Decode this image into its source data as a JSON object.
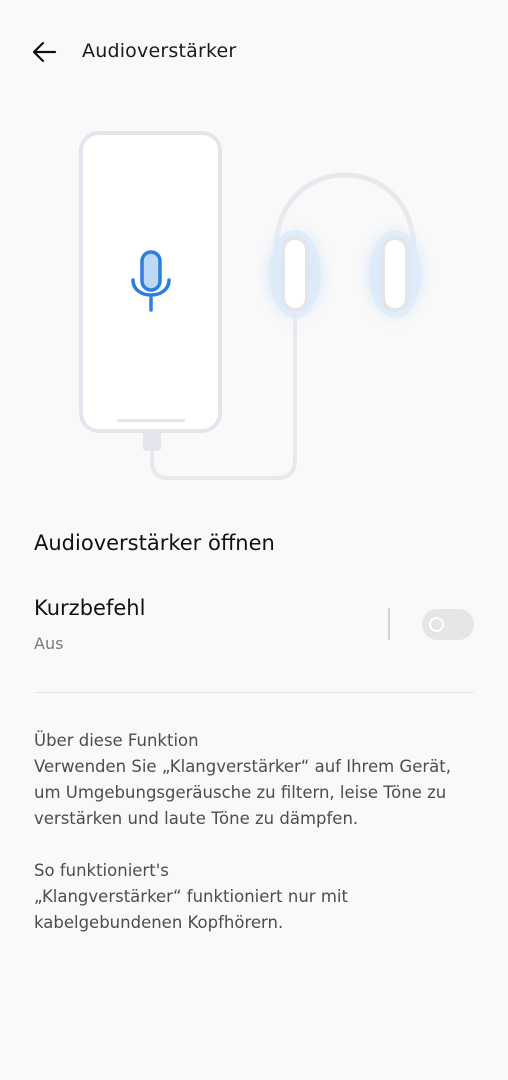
{
  "header": {
    "title": "Audioverstärker"
  },
  "open_row": {
    "label": "Audioverstärker öffnen"
  },
  "shortcut": {
    "title": "Kurzbefehl",
    "status": "Aus",
    "enabled": false
  },
  "info": {
    "about_heading": "Über diese Funktion",
    "about_text": "Verwenden Sie „Klangverstärker“ auf Ihrem Gerät, um Umgebungsgeräusche zu filtern, leise Töne zu verstärken und laute Töne zu dämpfen.",
    "how_heading": "So funktioniert's",
    "how_text": "„Klangverstärker“ funktioniert nur mit kabelgebundenen Kopfhörern."
  },
  "colors": {
    "accent": "#2b7fe0",
    "toggle_off": "#e6e6e6",
    "background": "#f9f9f9"
  },
  "icons": {
    "back": "arrow-left-icon",
    "mic": "microphone-icon"
  }
}
